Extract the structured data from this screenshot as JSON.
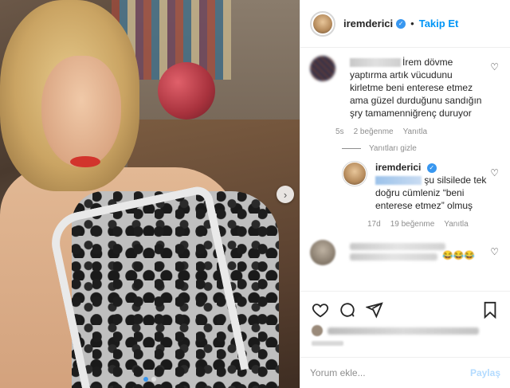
{
  "post": {
    "username": "iremderici",
    "separator": "•",
    "follow_label": "Takip Et",
    "carousel_next_glyph": "›"
  },
  "comments": [
    {
      "text": "İrem dövme yaptırma artık vücudunu kirletme beni enterese etmez ama güzel durduğunu sandığın şry tamamenniğrenç duruyor",
      "time": "5s",
      "likes": "2 beğenme",
      "reply_label": "Yanıtla",
      "hide_replies_label": "Yanıtları gizle"
    }
  ],
  "reply": {
    "username": "iremderici",
    "text": "şu silsilede tek doğru cümleniz “beni enterese etmez” olmuş",
    "time": "17d",
    "likes": "19 beğenme",
    "reply_label": "Yanıtla"
  },
  "third_comment": {
    "emoji": "😂😂😂"
  },
  "add_comment": {
    "placeholder": "Yorum ekle...",
    "post_label": "Paylaş"
  },
  "icons": [
    "heart-icon",
    "comment-icon",
    "share-icon",
    "bookmark-icon",
    "verified-icon",
    "more-icon"
  ],
  "colors": {
    "accent": "#0095f6",
    "verified": "#3897f0",
    "post_disabled": "#b3dbff"
  }
}
